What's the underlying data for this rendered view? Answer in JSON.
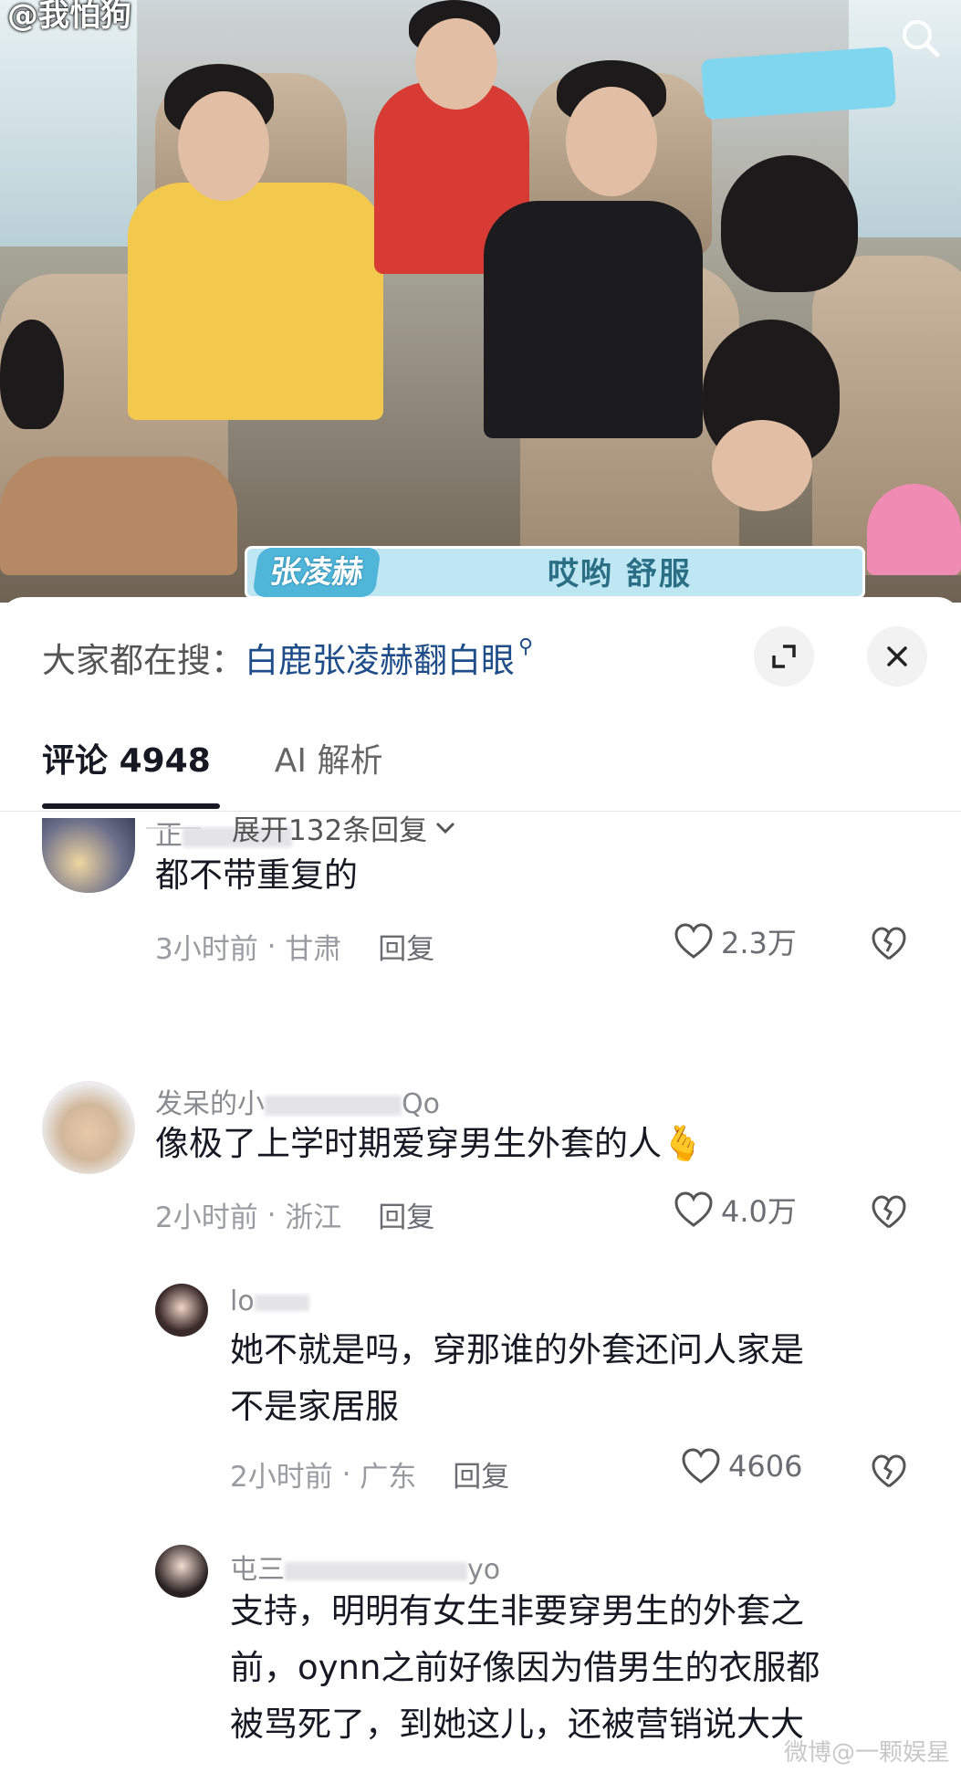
{
  "video": {
    "uploader_watermark": "@我怕狗",
    "caption_name": "张凌赫",
    "caption_text": "哎哟 舒服"
  },
  "search_bar": {
    "prefix": "大家都在搜：",
    "term": "白鹿张凌赫翻白眼"
  },
  "tabs": {
    "comments_label": "评论",
    "comments_count": "4948",
    "ai_label": "AI 解析"
  },
  "comments": [
    {
      "username": "正",
      "text": "都不带重复的",
      "time": "3小时前",
      "location": "甘肃",
      "reply_label": "回复",
      "likes": "2.3万"
    },
    {
      "username_prefix": "发呆的小",
      "username_suffix": "Qo",
      "text": "像极了上学时期爱穿男生外套的人🫰",
      "time": "2小时前",
      "location": "浙江",
      "reply_label": "回复",
      "likes": "4.0万"
    }
  ],
  "expand_replies": "展开132条回复",
  "replies": [
    {
      "username": "lo",
      "text_line1": "她不就是吗，穿那谁的外套还问人家是",
      "text_line2": "不是家居服",
      "time": "2小时前",
      "location": "广东",
      "reply_label": "回复",
      "likes": "4606"
    },
    {
      "username_prefix": "屯三",
      "username_suffix": "yo",
      "text_line1": "支持，明明有女生非要穿男生的外套之",
      "text_line2": "前，oynn之前好像因为借男生的衣服都",
      "text_line3": "被骂死了，到她这儿，还被营销说大大"
    }
  ],
  "footer_watermark": "微博@一颗娱星"
}
